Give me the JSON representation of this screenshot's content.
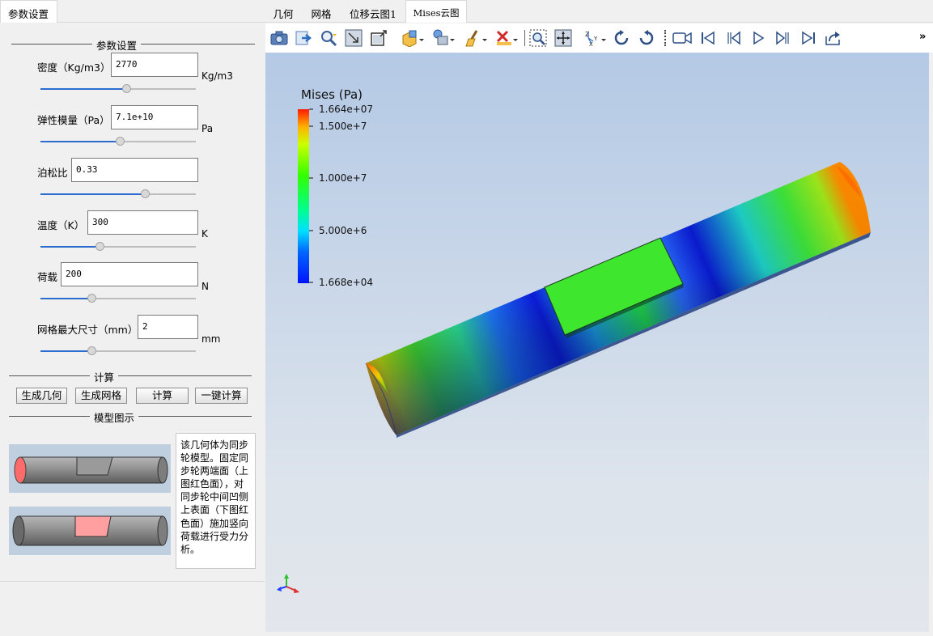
{
  "left_tab": {
    "label": "参数设置"
  },
  "params": {
    "group_title": "参数设置",
    "density": {
      "label": "密度（Kg/m3）",
      "value": "2770",
      "unit": "Kg/m3",
      "slider": 0.55
    },
    "modulus": {
      "label": "弹性模量（Pa）",
      "value": "7.1e+10",
      "unit": "Pa",
      "slider": 0.51
    },
    "poisson": {
      "label": "泊松比",
      "value": "0.33",
      "unit": "",
      "slider": 0.67
    },
    "temperature": {
      "label": "温度（K）",
      "value": "300",
      "unit": "K",
      "slider": 0.38
    },
    "load": {
      "label": "荷载",
      "value": "200",
      "unit": "N",
      "slider": 0.33
    },
    "mesh_size": {
      "label": "网格最大尺寸（mm）",
      "value": "2",
      "unit": "mm",
      "slider": 0.33
    }
  },
  "compute": {
    "group_title": "计算",
    "gen_geometry": "生成几何",
    "gen_mesh": "生成网格",
    "calculate": "计算",
    "one_click": "一键计算"
  },
  "model": {
    "group_title": "模型图示",
    "description": "该几何体为同步轮模型。固定同步轮两端面（上图红色面），对同步轮中间凹侧上表面（下图红色面）施加竖向荷载进行受力分析。"
  },
  "right_tabs": [
    {
      "label": "几何"
    },
    {
      "label": "网格"
    },
    {
      "label": "位移云图1"
    },
    {
      "label": "Mises云图"
    }
  ],
  "active_tab": "Mises云图",
  "toolbar": {
    "more": "»"
  },
  "legend": {
    "title": "Mises (Pa)",
    "max": "1.664e+07",
    "t1": "1.500e+7",
    "t2": "1.000e+7",
    "t3": "5.000e+6",
    "min": "1.668e+04"
  },
  "colors": {
    "accent": "#2b6cd1",
    "fixed_face": "#ff6b6b",
    "load_face": "#ff9f9f"
  }
}
